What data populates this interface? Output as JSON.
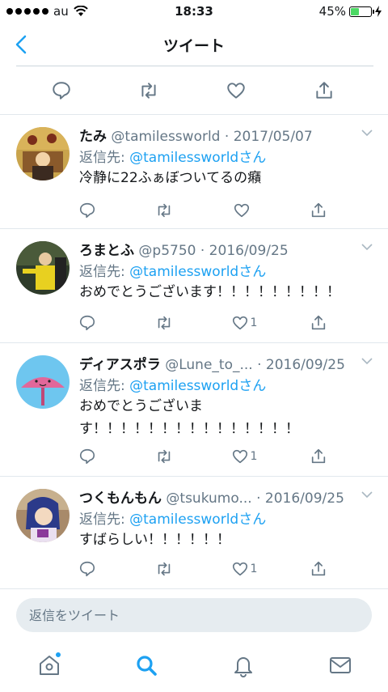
{
  "status_bar": {
    "carrier": "au",
    "time": "18:33",
    "battery_pct": "45%",
    "battery_level": 0.45
  },
  "header": {
    "title": "ツイート"
  },
  "colors": {
    "accent": "#1da1f2",
    "muted": "#657786",
    "text": "#14171a"
  },
  "replies": [
    {
      "name": "たみ",
      "handle": "@tamilessworld",
      "date": "· 2017/05/07",
      "reply_to_prefix": "返信先: ",
      "reply_to": "@tamilessworldさん",
      "text": "冷静に22ふぁぼついてるの癪",
      "likes": ""
    },
    {
      "name": "ろまとふ",
      "handle": "@p5750",
      "date": "· 2016/09/25",
      "reply_to_prefix": "返信先: ",
      "reply_to": "@tamilessworldさん",
      "text": "おめでとうございます！！！！！！！！！",
      "likes": "1"
    },
    {
      "name": "ディアスポラ",
      "handle": "@Lune_to_...",
      "date": "· 2016/09/25",
      "reply_to_prefix": "返信先: ",
      "reply_to": "@tamilessworldさん",
      "text": "おめでとうございま す！！！！！！！！！！！！！！！",
      "likes": "1"
    },
    {
      "name": "つくもんもん",
      "handle": "@tsukumo...",
      "date": "· 2016/09/25",
      "reply_to_prefix": "返信先: ",
      "reply_to": "@tamilessworldさん",
      "text": "すばらしい！！！！！！",
      "likes": "1"
    }
  ],
  "reply_bar": {
    "placeholder": "返信をツイート"
  },
  "tabs": [
    "home-icon",
    "search-icon",
    "bell-icon",
    "mail-icon"
  ]
}
